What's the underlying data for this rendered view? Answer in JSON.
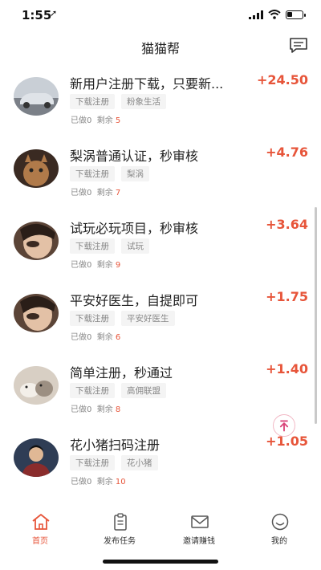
{
  "status": {
    "time": "1:55",
    "location_arrow": "➚"
  },
  "nav": {
    "title": "猫猫帮"
  },
  "tasks": [
    {
      "title": "新用户注册下载，只要新...",
      "price": "+24.50",
      "tags": [
        "下载注册",
        "粉象生活"
      ],
      "done_label": "已做",
      "done": "0",
      "left_label": "剩余",
      "left": "5"
    },
    {
      "title": "梨涡普通认证，秒审核",
      "price": "+4.76",
      "tags": [
        "下载注册",
        "梨涡"
      ],
      "done_label": "已做",
      "done": "0",
      "left_label": "剩余",
      "left": "7"
    },
    {
      "title": "试玩必玩项目，秒审核",
      "price": "+3.64",
      "tags": [
        "下载注册",
        "试玩"
      ],
      "done_label": "已做",
      "done": "0",
      "left_label": "剩余",
      "left": "9"
    },
    {
      "title": "平安好医生，自提即可",
      "price": "+1.75",
      "tags": [
        "下载注册",
        "平安好医生"
      ],
      "done_label": "已做",
      "done": "0",
      "left_label": "剩余",
      "left": "6"
    },
    {
      "title": "简单注册，秒通过",
      "price": "+1.40",
      "tags": [
        "下载注册",
        "高佣联盟"
      ],
      "done_label": "已做",
      "done": "0",
      "left_label": "剩余",
      "left": "8"
    },
    {
      "title": "花小猪扫码注册",
      "price": "+1.05",
      "tags": [
        "下载注册",
        "花小猪"
      ],
      "done_label": "已做",
      "done": "0",
      "left_label": "剩余",
      "left": "10"
    }
  ],
  "tabs": [
    {
      "label": "首页",
      "icon": "home-icon",
      "active": true
    },
    {
      "label": "发布任务",
      "icon": "clipboard-icon",
      "active": false
    },
    {
      "label": "邀请赚钱",
      "icon": "envelope-icon",
      "active": false
    },
    {
      "label": "我的",
      "icon": "smile-icon",
      "active": false
    }
  ],
  "colors": {
    "accent": "#e7553a",
    "to_top": "#d9467a"
  }
}
